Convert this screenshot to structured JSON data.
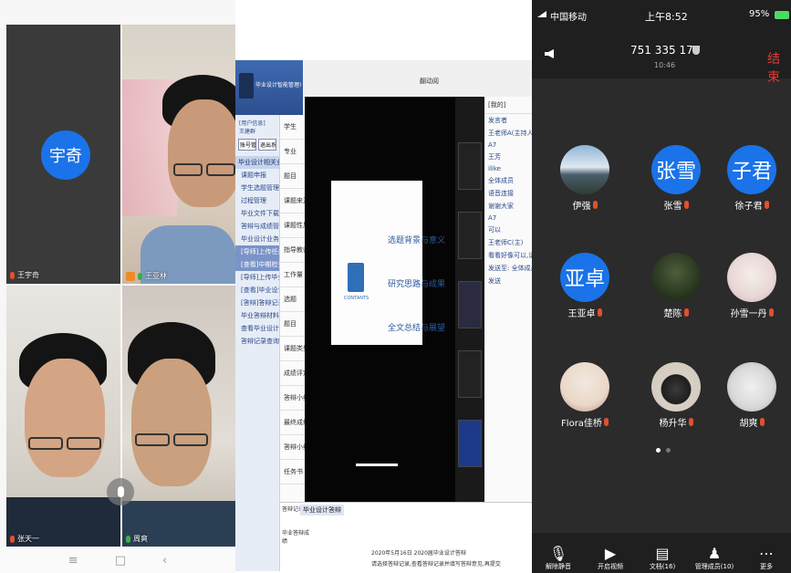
{
  "left_grid": {
    "tiles": [
      {
        "name": "王宇奇",
        "avatar_text": "宇奇"
      },
      {
        "name": "王亚林"
      },
      {
        "name": "张天一"
      },
      {
        "name": "周爽"
      }
    ],
    "nav_bar": {
      "menu": "≡",
      "home": "□",
      "back": "‹"
    }
  },
  "screen_share": {
    "app_title": "毕业设计智能管理系统",
    "top_title": "翻动阅",
    "user_info": "王建群 ",
    "sidebar_header": "[用户信息]",
    "btn_one": "账号管理",
    "btn_two": "退出系统",
    "section_one": "毕业设计相关业务",
    "sidebar_items": [
      "课题申报",
      "学生选题管理",
      "过程管理",
      "毕业文件下载",
      "答辩与成绩管理",
      "毕业设计业务",
      "[导师]上传任务书",
      "[查看]中期检查",
      "[导师]上传毕业设计",
      "[查看]毕业设计(论文)审核",
      "[答辩]答辩记录",
      "毕业答辩材料上传",
      "查看毕业设计评分",
      "答辩记录查询"
    ],
    "form_rows": [
      "学生",
      "专业",
      "题目",
      "课题来源",
      "课题性质",
      "指导教师",
      "工作量 难度",
      "选题",
      "题目",
      "课题类型",
      "成绩评定与答辩",
      "答辩小组意见",
      "最终成绩",
      "答辩小组成员",
      "任务书"
    ],
    "slide_items": [
      "选题背景与意义",
      "研究思路与成果",
      "全文总结与展望"
    ],
    "slide_logo_text": "CONTANTS",
    "chat_header": "[我的]",
    "chat_lines": [
      "发言者",
      "王老师A(主持人)",
      "A7",
      "王芳",
      "ilike",
      "全体成员",
      "语音连接",
      "谢谢大家",
      "A7",
      "可以",
      "王老师C(主)",
      "看看好像可以,请检查课题运行",
      "发送至: 全体成员",
      "发送"
    ],
    "bottom_label": "答辩记录",
    "bottom_tab": "毕业设计答辩",
    "bottom_text_one": "2020年5月16日 2020届毕业设计答辩",
    "bottom_text_two": "请选择答辩记录,查看答辩记录并填写答辩意见,再提交",
    "footer_left": "毕业答辩成绩"
  },
  "phone": {
    "carrier": "中国移动",
    "time": "上午8:52",
    "battery": "95%",
    "meeting_id": "751 335 175",
    "duration": "10:46",
    "end_label": "结束",
    "participants": [
      {
        "name": "伊强",
        "avatar_text": ""
      },
      {
        "name": "张雪",
        "avatar_text": "张雪"
      },
      {
        "name": "徐子君",
        "avatar_text": "子君"
      },
      {
        "name": "王亚卓",
        "avatar_text": "亚卓"
      },
      {
        "name": "楚陈",
        "avatar_text": ""
      },
      {
        "name": "孙雪一丹",
        "avatar_text": ""
      },
      {
        "name": "Flora佳桥",
        "avatar_text": ""
      },
      {
        "name": "杨升华",
        "avatar_text": ""
      },
      {
        "name": "胡爽",
        "avatar_text": ""
      }
    ],
    "toolbar": [
      {
        "label": "解除静音",
        "icon": "mic-off-icon"
      },
      {
        "label": "开启视频",
        "icon": "video-off-icon"
      },
      {
        "label": "文档(16)",
        "icon": "document-icon"
      },
      {
        "label": "管理成员(10)",
        "icon": "members-icon"
      },
      {
        "label": "更多",
        "icon": "more-icon"
      }
    ]
  },
  "colors": {
    "accent": "#1a73e8",
    "phone_bg": "#2b2b2b",
    "end_red": "#e53935"
  }
}
